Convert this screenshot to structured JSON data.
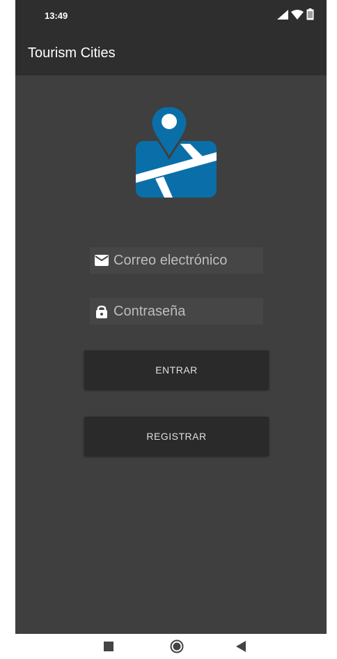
{
  "status_bar": {
    "time": "13:49",
    "icons": [
      "signal-icon",
      "wifi-icon",
      "battery-icon"
    ]
  },
  "app_bar": {
    "title": "Tourism Cities"
  },
  "logo": {
    "icon": "map-pin-icon",
    "colors": {
      "pin": "#0a6fa8",
      "map": "#0a6fa8",
      "roads": "#ffffff"
    }
  },
  "login_form": {
    "email": {
      "placeholder": "Correo electrónico",
      "value": "",
      "icon": "email-icon"
    },
    "password": {
      "placeholder": "Contraseña",
      "value": "",
      "icon": "lock-icon"
    },
    "login_button": "ENTRAR",
    "register_button": "REGISTRAR"
  },
  "nav_bar": {
    "buttons": [
      "recents-icon",
      "home-icon",
      "back-icon"
    ]
  },
  "colors": {
    "background": "#3f3f3f",
    "app_bar": "#2e2e2e",
    "button": "#2a2a2a",
    "field": "#464646"
  }
}
